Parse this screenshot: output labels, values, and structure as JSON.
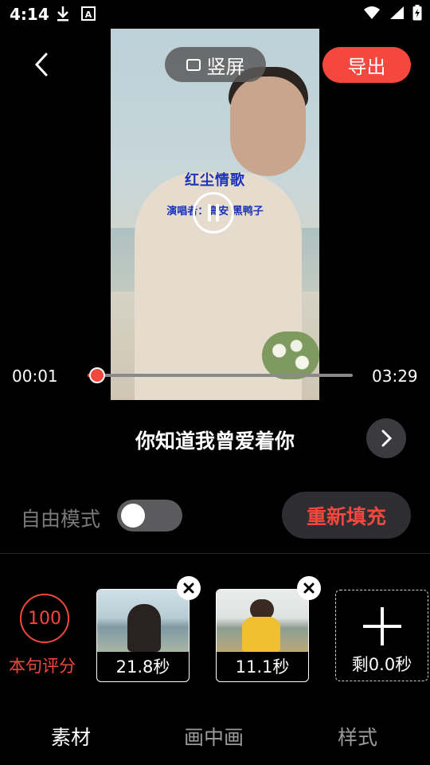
{
  "status_bar": {
    "time": "4:14",
    "icons": [
      "download-icon",
      "a-font-icon",
      "wifi-icon",
      "signal-icon",
      "battery-charging-icon"
    ]
  },
  "header": {
    "portrait_label": "竖屏",
    "export_label": "导出"
  },
  "video": {
    "song_title": "红尘情歌",
    "song_singer": "演唱者：高安 黑鸭子",
    "state": "playing"
  },
  "player": {
    "current_time": "00:01",
    "total_time": "03:29",
    "progress_percent": 0.5
  },
  "lyric": {
    "text": "你知道我曾爱着你"
  },
  "controls": {
    "free_mode_label": "自由模式",
    "free_mode_on": false,
    "refill_label": "重新填充"
  },
  "score": {
    "value": "100",
    "label": "本句评分"
  },
  "clips": [
    {
      "duration": "21.8秒"
    },
    {
      "duration": "11.1秒"
    }
  ],
  "add_clip": {
    "remaining": "剩0.0秒"
  },
  "tabs": [
    {
      "label": "素材",
      "active": true
    },
    {
      "label": "画中画",
      "active": false
    },
    {
      "label": "样式",
      "active": false
    }
  ],
  "colors": {
    "accent": "#f4473e",
    "background": "#000000"
  }
}
